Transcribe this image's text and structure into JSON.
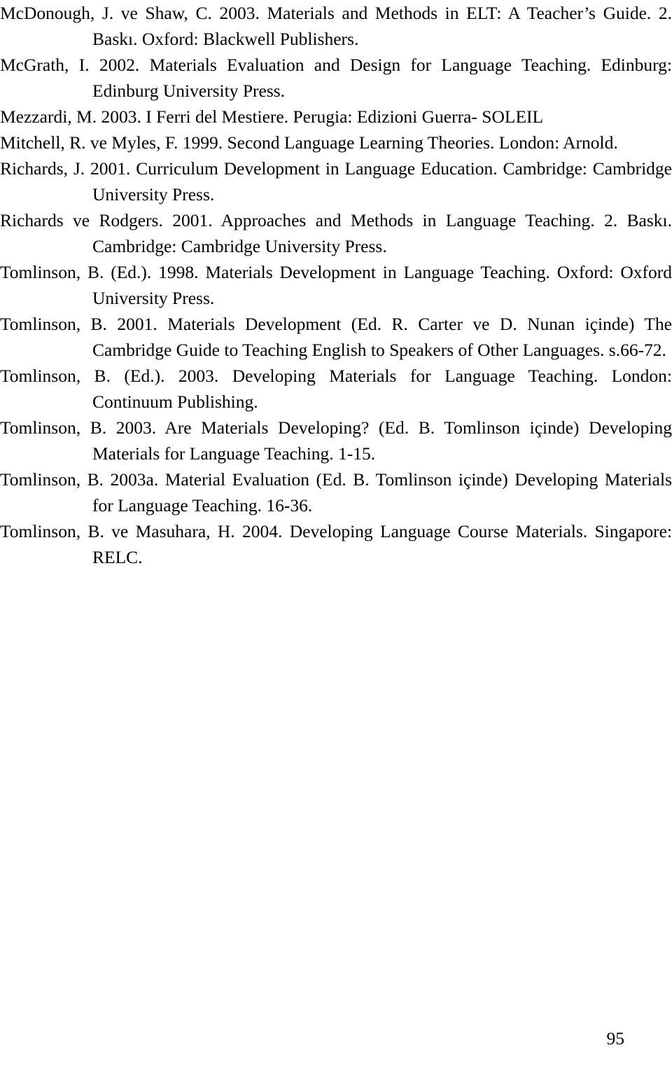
{
  "document": {
    "type": "bibliography-page",
    "page_number": "95",
    "references": [
      "McDonough, J. ve Shaw, C. 2003. Materials and Methods in ELT: A Teacher’s Guide. 2. Baskı. Oxford: Blackwell Publishers.",
      "McGrath, I. 2002. Materials Evaluation and Design for Language Teaching. Edinburg: Edinburg University Press.",
      "Mezzardi, M. 2003. I Ferri del Mestiere. Perugia: Edizioni Guerra- SOLEIL",
      "Mitchell, R. ve Myles, F. 1999. Second Language Learning Theories. London: Arnold.",
      "Richards, J. 2001. Curriculum Development in Language Education. Cambridge: Cambridge University Press.",
      "Richards ve Rodgers. 2001. Approaches and Methods in Language Teaching. 2. Baskı. Cambridge: Cambridge University Press.",
      "Tomlinson, B. (Ed.). 1998. Materials Development in Language Teaching. Oxford: Oxford University Press.",
      "Tomlinson, B. 2001. Materials Development (Ed. R. Carter ve D. Nunan içinde) The Cambridge Guide to Teaching English to Speakers of Other Languages. s.66-72.",
      "Tomlinson, B. (Ed.). 2003. Developing Materials for Language Teaching. London: Continuum Publishing.",
      "Tomlinson, B. 2003. Are Materials Developing? (Ed. B. Tomlinson içinde) Developing Materials for Language Teaching. 1-15.",
      "Tomlinson, B. 2003a. Material Evaluation (Ed. B. Tomlinson içinde) Developing Materials for Language Teaching. 16-36.",
      "Tomlinson, B. ve Masuhara, H. 2004. Developing Language Course Materials. Singapore: RELC."
    ]
  }
}
